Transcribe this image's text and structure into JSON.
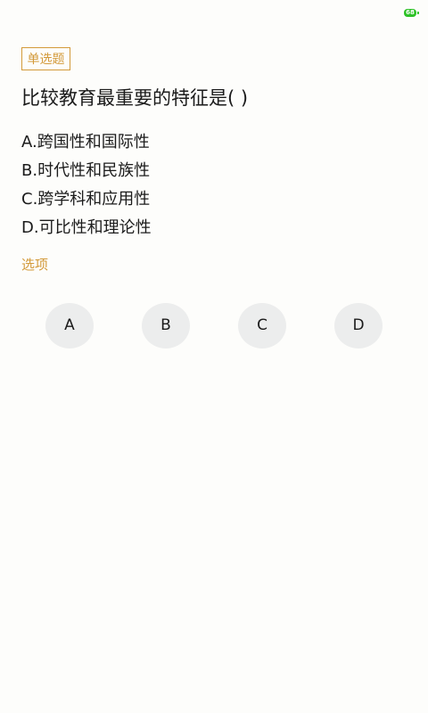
{
  "status_bar": {
    "battery_level": "68",
    "battery_color": "#2ec227"
  },
  "question": {
    "type_tag": "单选题",
    "text": "比较教育最重要的特征是( )",
    "options": [
      {
        "letter": "A",
        "text": "A.跨国性和国际性"
      },
      {
        "letter": "B",
        "text": "B.时代性和民族性"
      },
      {
        "letter": "C",
        "text": "C.跨学科和应用性"
      },
      {
        "letter": "D",
        "text": "D.可比性和理论性"
      }
    ]
  },
  "answer_section": {
    "label": "选项",
    "buttons": [
      "A",
      "B",
      "C",
      "D"
    ]
  },
  "theme": {
    "accent": "#d39a3a",
    "button_bg": "#eceded",
    "background": "#fdfdfb"
  }
}
